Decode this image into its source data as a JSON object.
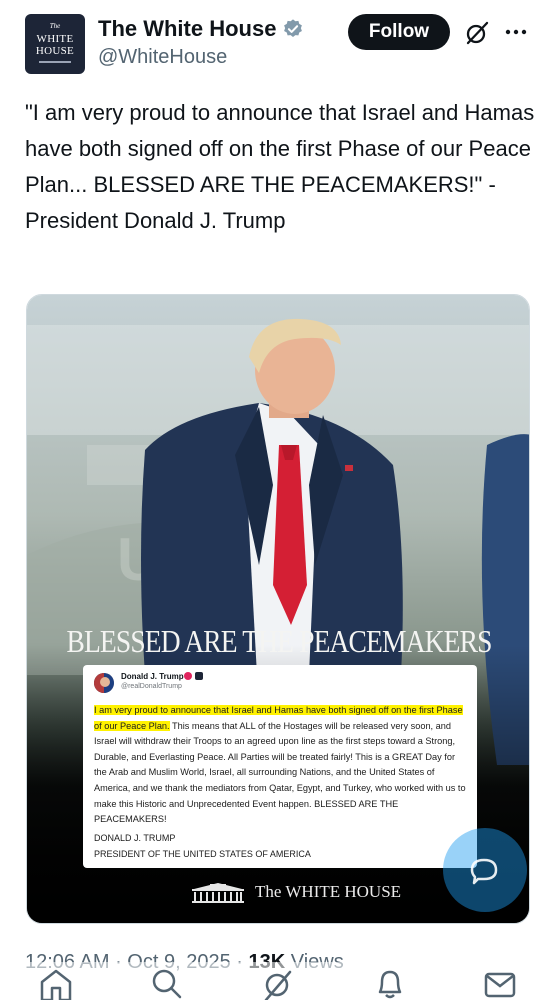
{
  "author": {
    "name": "The White House",
    "handle": "@WhiteHouse",
    "avatar_text": [
      "The",
      "WHITE",
      "HOUSE"
    ],
    "verified": true
  },
  "follow_label": "Follow",
  "tweet_text": "\"I am very proud to announce that Israel and Hamas have both signed off on the first Phase of our Peace Plan... BLESSED ARE THE PEACEMAKERS!\" - President Donald J. Trump",
  "media": {
    "headline": "BLESSED ARE THE PEACEMAKERS",
    "card": {
      "name": "Donald J. Trump",
      "handle": "@realDonaldTrump",
      "highlighted": "I am very proud to announce that Israel and Hamas have both signed off on the first Phase of our Peace Plan.",
      "body": " This means that ALL of the Hostages will be released very soon, and Israel will withdraw their Troops to an agreed upon line as the first steps toward a Strong, Durable, and Everlasting Peace. All Parties will be treated fairly! This is a GREAT Day for the Arab and Muslim World, Israel, all surrounding Nations, and the United States of America, and we thank the mediators from Qatar, Egypt, and Turkey, who worked with us to make this Historic and Unprecedented Event happen. BLESSED ARE THE PEACEMAKERS!",
      "signature_line1": "DONALD J. TRUMP",
      "signature_line2": "PRESIDENT OF THE UNITED STATES OF AMERICA"
    },
    "logo_text": "The WHITE HOUSE"
  },
  "meta": {
    "time": "12:06 AM",
    "sep1": " · ",
    "date": "Oct 9, 2025",
    "sep2": " · ",
    "views_count": "13K",
    "views_label": " Views"
  },
  "icons": [
    "verified-badge-icon",
    "grok-icon",
    "more-icon",
    "compose-reply-icon",
    "home-icon",
    "search-icon",
    "grok-tab-icon",
    "notifications-icon",
    "messages-icon"
  ],
  "colors": {
    "accent": "#1d9bf0",
    "text": "#0f1419",
    "secondary": "#536471",
    "highlight": "#fff200"
  }
}
